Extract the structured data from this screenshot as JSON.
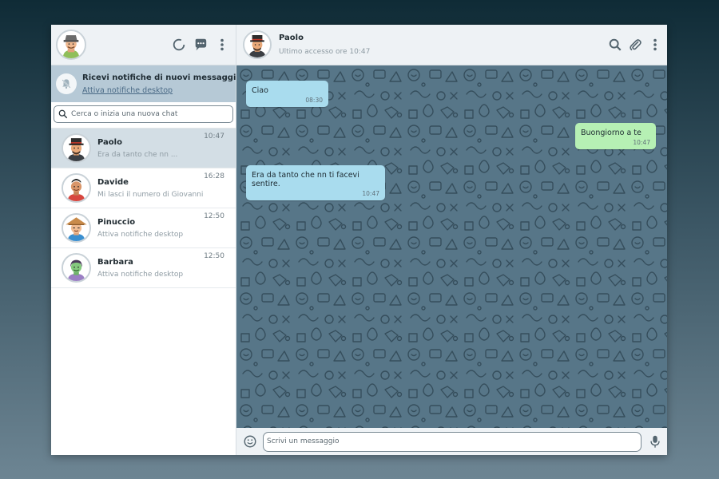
{
  "sidebar": {
    "header": {
      "avatar": "user-avatar-farmer"
    },
    "icons": [
      "status-icon",
      "new-chat-icon",
      "menu-dots-icon"
    ],
    "notification": {
      "title": "Ricevi notifiche di nuovi messaggi",
      "link": "Attiva notifiche desktop"
    },
    "search": {
      "placeholder": "Cerca o inizia una nuova chat",
      "value": ""
    },
    "chats": [
      {
        "name": "Paolo",
        "preview": "Era da tanto che nn ...",
        "time": "10:47",
        "active": true
      },
      {
        "name": "Davide",
        "preview": "Mi lasci il numero di Giovanni",
        "time": "16:28",
        "active": false
      },
      {
        "name": "Pinuccio",
        "preview": "Attiva notifiche desktop",
        "time": "12:50",
        "active": false
      },
      {
        "name": "Barbara",
        "preview": "Attiva notifiche desktop",
        "time": "12:50",
        "active": false
      }
    ]
  },
  "conversation": {
    "contact": {
      "name": "Paolo",
      "status": "Ultimo accesso ore 10:47"
    },
    "icons": [
      "search-icon",
      "attach-icon",
      "menu-dots-icon"
    ],
    "messages": [
      {
        "text": "Ciao",
        "time": "08:30",
        "direction": "in"
      },
      {
        "text": "Buongiorno a te",
        "time": "10:47",
        "direction": "out"
      },
      {
        "text": "Era da tanto che nn ti facevi sentire.",
        "time": "10:47",
        "direction": "in"
      }
    ]
  },
  "composer": {
    "placeholder": "Scrivi un messaggio",
    "value": ""
  },
  "colors": {
    "incoming_bubble": "#a9dcee",
    "outgoing_bubble": "#b6f0b4",
    "active_chat": "#d3dee5",
    "notification_bar": "#b6c9d6",
    "chat_background": "#577688"
  }
}
